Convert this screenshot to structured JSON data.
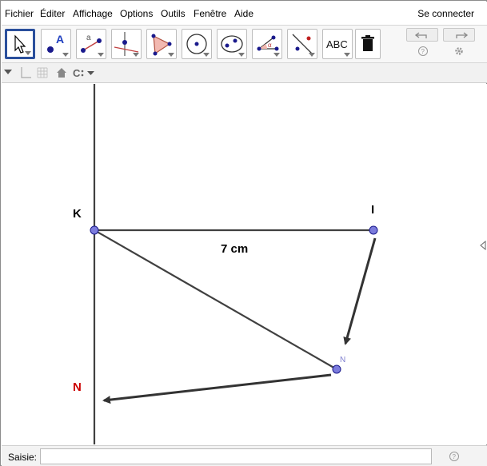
{
  "menu": {
    "items": [
      "Fichier",
      "Éditer",
      "Affichage",
      "Options",
      "Outils",
      "Fenêtre",
      "Aide"
    ],
    "login": "Se connecter"
  },
  "toolbar": {
    "tools": [
      {
        "name": "move-tool",
        "selected": true
      },
      {
        "name": "point-tool"
      },
      {
        "name": "segment-tool"
      },
      {
        "name": "perpendicular-line-tool"
      },
      {
        "name": "polygon-tool"
      },
      {
        "name": "circle-tool"
      },
      {
        "name": "conic-tool"
      },
      {
        "name": "angle-tool"
      },
      {
        "name": "reflect-tool"
      },
      {
        "name": "text-tool",
        "label": "ABC"
      },
      {
        "name": "delete-tool"
      }
    ],
    "undo": "undo-icon",
    "redo": "redo-icon",
    "help": "help-icon",
    "settings": "gear-icon"
  },
  "stylebar": {
    "icons": [
      "toggle-stylebar-icon",
      "axes-icon",
      "grid-icon",
      "home-icon",
      "point-capturing-icon"
    ]
  },
  "graphics": {
    "labels": {
      "K": "K",
      "I": "I",
      "N_small": "N",
      "N_red": "N",
      "segment": "7 cm"
    },
    "colors": {
      "point_fill": "#7b7bdc",
      "point_stroke": "#1a1a8c",
      "line": "#404040",
      "red_label": "#cc0000",
      "small_label": "#8080d0"
    }
  },
  "inputbar": {
    "label": "Saisie:",
    "value": "",
    "placeholder": ""
  }
}
